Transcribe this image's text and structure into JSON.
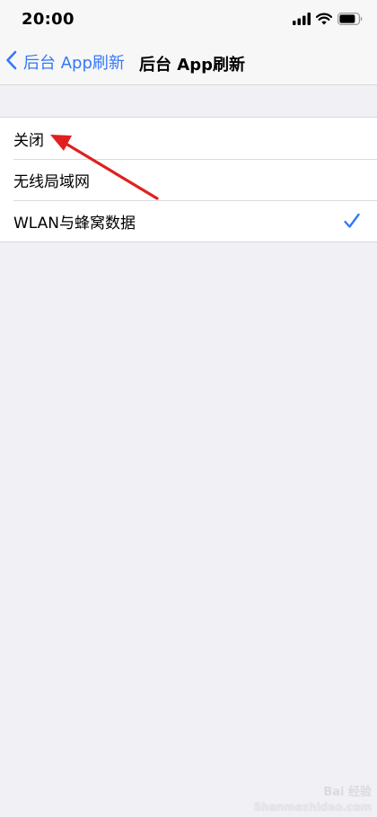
{
  "status_bar": {
    "time": "20:00",
    "icons": [
      "signal-icon",
      "wifi-icon",
      "battery-icon"
    ]
  },
  "nav": {
    "back_label": "后台 App刷新",
    "title": "后台 App刷新"
  },
  "options": [
    {
      "label": "关闭",
      "selected": false
    },
    {
      "label": "无线局域网",
      "selected": false
    },
    {
      "label": "WLAN与蜂窝数据",
      "selected": true
    }
  ],
  "annotation": {
    "type": "arrow",
    "color": "#e02020",
    "points_to": "关闭"
  },
  "watermark": {
    "logo": "Bai 经验",
    "url": "Shenmezhidao.com"
  },
  "colors": {
    "accent": "#3478f6",
    "background": "#f0f0f5",
    "row_background": "#ffffff",
    "separator": "#d8d8dc"
  }
}
